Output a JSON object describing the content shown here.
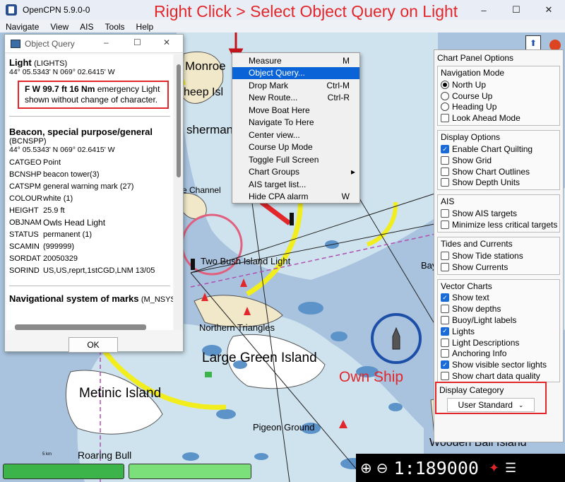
{
  "window": {
    "title": "OpenCPN 5.9.0-0",
    "minimize": "–",
    "maximize": "☐",
    "close": "✕"
  },
  "menu": [
    "Navigate",
    "View",
    "AIS",
    "Tools",
    "Help"
  ],
  "annotation_top": "Right Click > Select Object Query on Light",
  "annotation_ship": "Own Ship",
  "object_query": {
    "title": "Object Query",
    "light_title": "Light",
    "light_code": "(LIGHTS)",
    "light_coords": "44° 05.5343' N 069° 02.6415' W",
    "light_desc_bold": "F W 99.7 ft 16 Nm",
    "light_desc_rest": " emergency Light shown without change of character.",
    "beacon_title": "Beacon, special purpose/general",
    "beacon_code": "(BCNSPP)",
    "beacon_coords": "44° 05.5343' N 069° 02.6415' W",
    "attributes": [
      {
        "k": "CATGEO",
        "v": "Point"
      },
      {
        "k": "BCNSHP",
        "v": "beacon tower(3)"
      },
      {
        "k": "CATSPM",
        "v": "general warning mark (27)"
      },
      {
        "k": "COLOUR",
        "v": "white (1)"
      },
      {
        "k": "HEIGHT",
        "v": "25.9 ft"
      },
      {
        "k": "OBJNAM",
        "v": "Owls Head Light"
      },
      {
        "k": "STATUS",
        "v": "permanent (1)"
      },
      {
        "k": "SCAMIN",
        "v": "(999999)"
      },
      {
        "k": "SORDAT",
        "v": "20050329"
      },
      {
        "k": "SORIND",
        "v": "US,US,reprt,1stCGD,LNM 13/05"
      }
    ],
    "nav_title": "Navigational system of marks",
    "nav_code": "(M_NSYS)",
    "ok": "OK"
  },
  "context_menu": [
    {
      "label": "Measure",
      "shortcut": "M"
    },
    {
      "label": "Object Query...",
      "shortcut": "",
      "selected": true
    },
    {
      "label": "Drop Mark",
      "shortcut": "Ctrl-M"
    },
    {
      "label": "New Route...",
      "shortcut": "Ctrl-R"
    },
    {
      "label": "Move Boat Here",
      "shortcut": ""
    },
    {
      "label": "Navigate To Here",
      "shortcut": ""
    },
    {
      "label": "Center view...",
      "shortcut": ""
    },
    {
      "label": "Course Up Mode",
      "shortcut": ""
    },
    {
      "label": "Toggle Full Screen",
      "shortcut": ""
    },
    {
      "label": "Chart Groups",
      "shortcut": "▸"
    },
    {
      "label": "AIS target list...",
      "shortcut": ""
    },
    {
      "label": "Hide CPA alarm",
      "shortcut": "W"
    }
  ],
  "panel": {
    "title": "Chart Panel Options",
    "navigation": {
      "header": "Navigation Mode",
      "options": [
        {
          "label": "North Up",
          "on": true
        },
        {
          "label": "Course Up",
          "on": false
        },
        {
          "label": "Heading Up",
          "on": false
        },
        {
          "label": "Look Ahead Mode",
          "on": false,
          "check": true
        }
      ]
    },
    "display": {
      "header": "Display Options",
      "options": [
        {
          "label": "Enable Chart Quilting",
          "on": true
        },
        {
          "label": "Show Grid",
          "on": false
        },
        {
          "label": "Show Chart Outlines",
          "on": false
        },
        {
          "label": "Show Depth Units",
          "on": false
        }
      ]
    },
    "ais": {
      "header": "AIS",
      "options": [
        {
          "label": "Show AIS targets",
          "on": false
        },
        {
          "label": "Minimize less critical targets",
          "on": false
        }
      ]
    },
    "tides": {
      "header": "Tides and Currents",
      "options": [
        {
          "label": "Show Tide stations",
          "on": false
        },
        {
          "label": "Show Currents",
          "on": false
        }
      ]
    },
    "vector": {
      "header": "Vector Charts",
      "options": [
        {
          "label": "Show text",
          "on": true
        },
        {
          "label": "Show depths",
          "on": false
        },
        {
          "label": "Buoy/Light labels",
          "on": false
        },
        {
          "label": "Lights",
          "on": true
        },
        {
          "label": "Light Descriptions",
          "on": false
        },
        {
          "label": "Anchoring Info",
          "on": false
        },
        {
          "label": "Show visible sector lights",
          "on": true
        },
        {
          "label": "Show chart data quality",
          "on": false
        }
      ]
    },
    "display_category": {
      "header": "Display Category",
      "value": "User Standard"
    }
  },
  "map_labels": {
    "monroe": "Monroe",
    "sheep": "heep Isl",
    "sherman": "sherman",
    "channel": "e Channel",
    "twobush": "Two Bush Island Light",
    "northern": "Northern Triangles",
    "largegreen": "Large Green Island",
    "metinic": "Metinic Island",
    "pigeon": "Pigeon Ground",
    "roaring": "Roaring Bull",
    "bay": "Bay",
    "wooden": "Wooden Ball Island",
    "scale_tick": "5 km"
  },
  "scale": "1:189000",
  "colors": {
    "accent": "#e2262a",
    "selection": "#0a64d8",
    "water": "#a9c3df",
    "shallow": "#cfe3ef",
    "land": "#f0e8c8",
    "green_bar": "#3db44a"
  }
}
